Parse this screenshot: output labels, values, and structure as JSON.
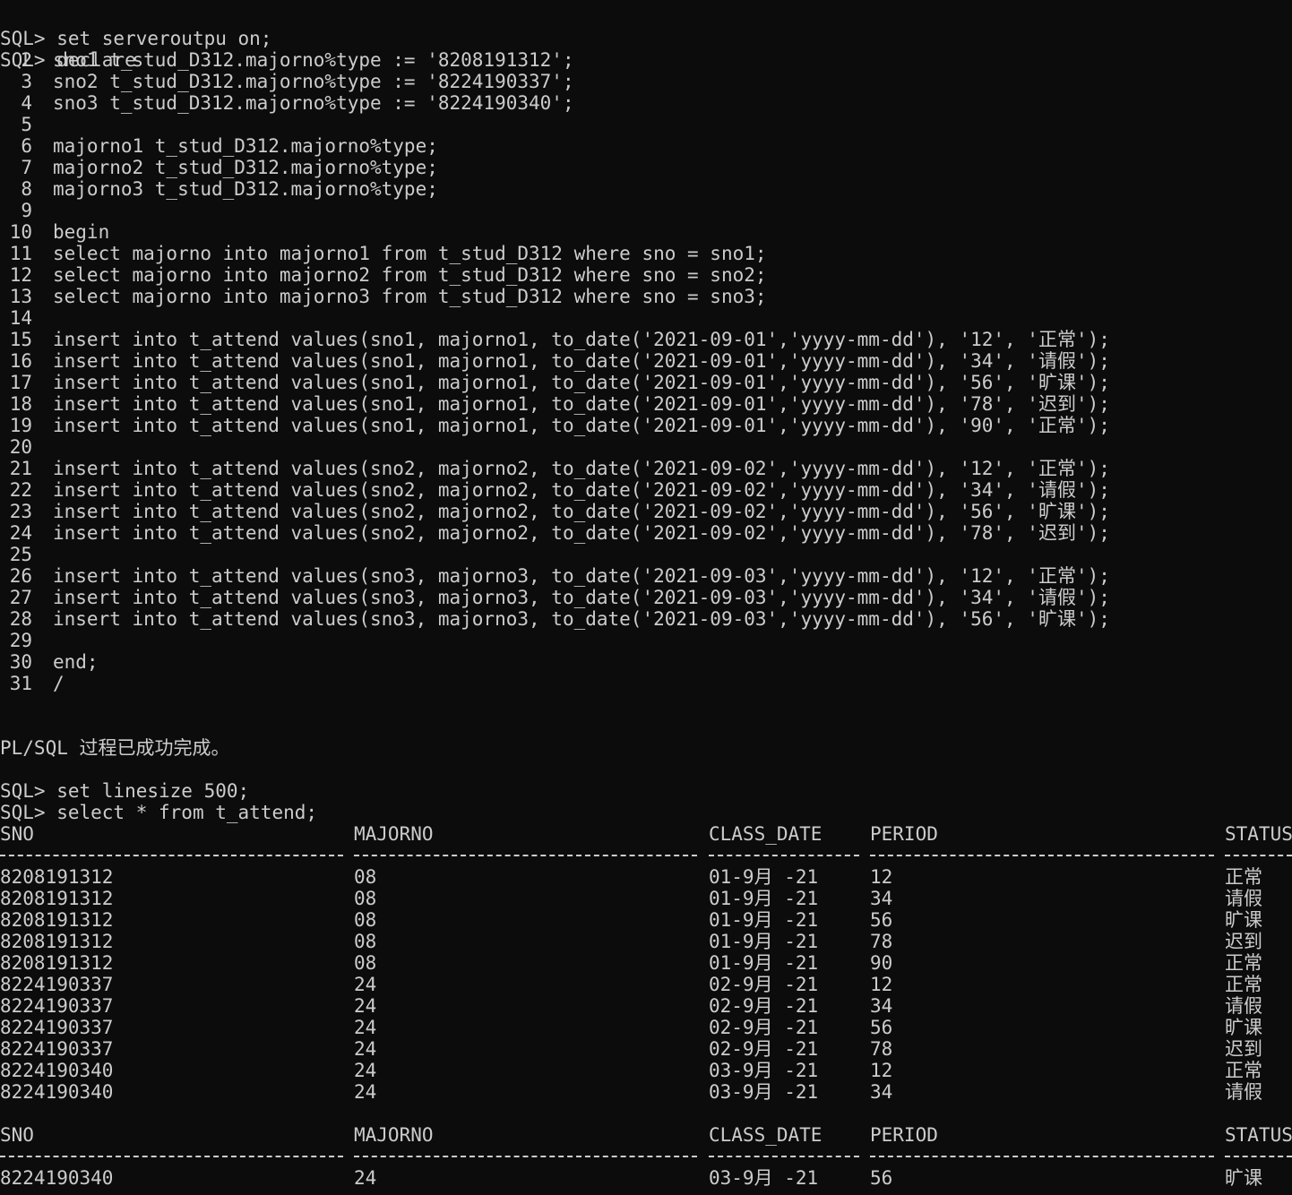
{
  "terminal": {
    "session_start": [
      {
        "prompt": "SQL>",
        "cmd": " set serveroutpu on;"
      },
      {
        "prompt": "SQL>",
        "cmd": " declare"
      }
    ],
    "block": [
      {
        "n": "2",
        "t": "sno1 t_stud_D312.majorno%type := '8208191312';"
      },
      {
        "n": "3",
        "t": "sno2 t_stud_D312.majorno%type := '8224190337';"
      },
      {
        "n": "4",
        "t": "sno3 t_stud_D312.majorno%type := '8224190340';"
      },
      {
        "n": "5",
        "t": ""
      },
      {
        "n": "6",
        "t": "majorno1 t_stud_D312.majorno%type;"
      },
      {
        "n": "7",
        "t": "majorno2 t_stud_D312.majorno%type;"
      },
      {
        "n": "8",
        "t": "majorno3 t_stud_D312.majorno%type;"
      },
      {
        "n": "9",
        "t": ""
      },
      {
        "n": "10",
        "t": "begin"
      },
      {
        "n": "11",
        "t": "select majorno into majorno1 from t_stud_D312 where sno = sno1;"
      },
      {
        "n": "12",
        "t": "select majorno into majorno2 from t_stud_D312 where sno = sno2;"
      },
      {
        "n": "13",
        "t": "select majorno into majorno3 from t_stud_D312 where sno = sno3;"
      },
      {
        "n": "14",
        "t": ""
      },
      {
        "n": "15",
        "t": "insert into t_attend values(sno1, majorno1, to_date('2021-09-01','yyyy-mm-dd'), '12', '正常');"
      },
      {
        "n": "16",
        "t": "insert into t_attend values(sno1, majorno1, to_date('2021-09-01','yyyy-mm-dd'), '34', '请假');"
      },
      {
        "n": "17",
        "t": "insert into t_attend values(sno1, majorno1, to_date('2021-09-01','yyyy-mm-dd'), '56', '旷课');"
      },
      {
        "n": "18",
        "t": "insert into t_attend values(sno1, majorno1, to_date('2021-09-01','yyyy-mm-dd'), '78', '迟到');"
      },
      {
        "n": "19",
        "t": "insert into t_attend values(sno1, majorno1, to_date('2021-09-01','yyyy-mm-dd'), '90', '正常');"
      },
      {
        "n": "20",
        "t": ""
      },
      {
        "n": "21",
        "t": "insert into t_attend values(sno2, majorno2, to_date('2021-09-02','yyyy-mm-dd'), '12', '正常');"
      },
      {
        "n": "22",
        "t": "insert into t_attend values(sno2, majorno2, to_date('2021-09-02','yyyy-mm-dd'), '34', '请假');"
      },
      {
        "n": "23",
        "t": "insert into t_attend values(sno2, majorno2, to_date('2021-09-02','yyyy-mm-dd'), '56', '旷课');"
      },
      {
        "n": "24",
        "t": "insert into t_attend values(sno2, majorno2, to_date('2021-09-02','yyyy-mm-dd'), '78', '迟到');"
      },
      {
        "n": "25",
        "t": ""
      },
      {
        "n": "26",
        "t": "insert into t_attend values(sno3, majorno3, to_date('2021-09-03','yyyy-mm-dd'), '12', '正常');"
      },
      {
        "n": "27",
        "t": "insert into t_attend values(sno3, majorno3, to_date('2021-09-03','yyyy-mm-dd'), '34', '请假');"
      },
      {
        "n": "28",
        "t": "insert into t_attend values(sno3, majorno3, to_date('2021-09-03','yyyy-mm-dd'), '56', '旷课');"
      },
      {
        "n": "29",
        "t": ""
      },
      {
        "n": "30",
        "t": "end;"
      },
      {
        "n": "31",
        "t": "/"
      }
    ],
    "result_message": "PL/SQL 过程已成功完成。",
    "followup": [
      {
        "prompt": "SQL>",
        "cmd": " set linesize 500;"
      },
      {
        "prompt": "SQL>",
        "cmd": " select * from t_attend;"
      }
    ],
    "table": {
      "headers": [
        "SNO",
        "MAJORNO",
        "CLASS_DATE",
        "PERIOD",
        "STATUS"
      ],
      "page1": [
        [
          "8208191312",
          "08",
          "01-9月 -21",
          "12",
          "正常"
        ],
        [
          "8208191312",
          "08",
          "01-9月 -21",
          "34",
          "请假"
        ],
        [
          "8208191312",
          "08",
          "01-9月 -21",
          "56",
          "旷课"
        ],
        [
          "8208191312",
          "08",
          "01-9月 -21",
          "78",
          "迟到"
        ],
        [
          "8208191312",
          "08",
          "01-9月 -21",
          "90",
          "正常"
        ],
        [
          "8224190337",
          "24",
          "02-9月 -21",
          "12",
          "正常"
        ],
        [
          "8224190337",
          "24",
          "02-9月 -21",
          "34",
          "请假"
        ],
        [
          "8224190337",
          "24",
          "02-9月 -21",
          "56",
          "旷课"
        ],
        [
          "8224190337",
          "24",
          "02-9月 -21",
          "78",
          "迟到"
        ],
        [
          "8224190340",
          "24",
          "03-9月 -21",
          "12",
          "正常"
        ],
        [
          "8224190340",
          "24",
          "03-9月 -21",
          "34",
          "请假"
        ]
      ],
      "page2": [
        [
          "8224190340",
          "24",
          "03-9月 -21",
          "56",
          "旷课"
        ]
      ]
    }
  }
}
